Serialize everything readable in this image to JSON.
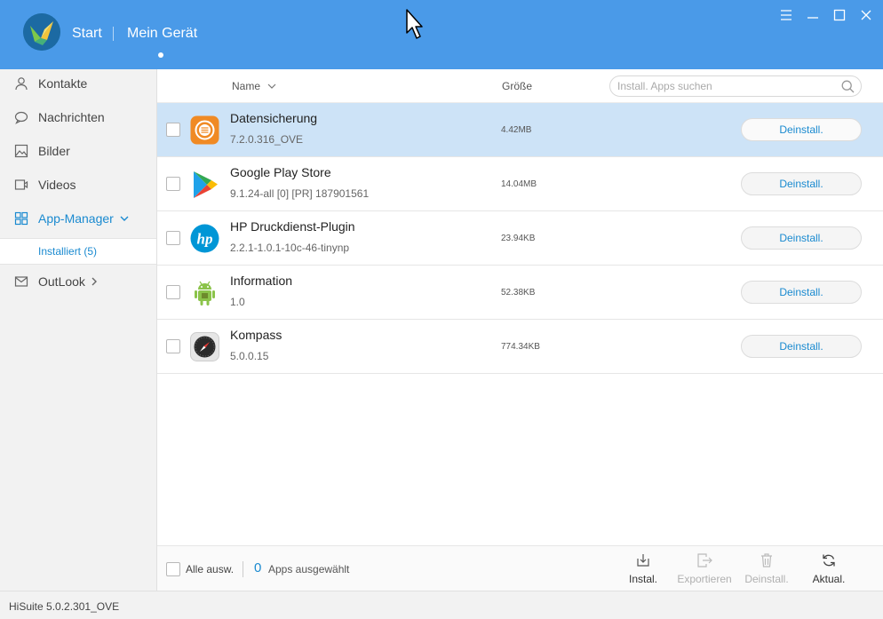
{
  "header": {
    "nav_start": "Start",
    "nav_device": "Mein Gerät",
    "accent": "#4a9ae8"
  },
  "sidebar": {
    "items": [
      {
        "label": "Kontakte",
        "icon": "person-icon"
      },
      {
        "label": "Nachrichten",
        "icon": "chat-bubble-icon"
      },
      {
        "label": "Bilder",
        "icon": "image-icon"
      },
      {
        "label": "Videos",
        "icon": "video-icon"
      },
      {
        "label": "App-Manager",
        "icon": "grid-icon"
      },
      {
        "label": "OutLook",
        "icon": "envelope-icon"
      }
    ],
    "sub_item": "Installiert (5)"
  },
  "table": {
    "col_name": "Name",
    "col_size": "Größe",
    "search_placeholder": "Install. Apps suchen",
    "uninstall_label": "Deinstall.",
    "rows": [
      {
        "name": "Datensicherung",
        "version": "7.2.0.316_OVE",
        "size": "4.42MB",
        "icon": "backup-app-icon",
        "selected": true
      },
      {
        "name": "Google Play Store",
        "version": "9.1.24-all [0] [PR] 187901561",
        "size": "14.04MB",
        "icon": "play-store-icon",
        "selected": false
      },
      {
        "name": "HP Druckdienst-Plugin",
        "version": "2.2.1-1.0.1-10c-46-tinynp",
        "size": "23.94KB",
        "icon": "hp-logo-icon",
        "selected": false
      },
      {
        "name": "Information",
        "version": "1.0",
        "size": "52.38KB",
        "icon": "android-icon",
        "selected": false
      },
      {
        "name": "Kompass",
        "version": "5.0.0.15",
        "size": "774.34KB",
        "icon": "compass-icon",
        "selected": false
      }
    ]
  },
  "bottom": {
    "select_all": "Alle ausw.",
    "selected_count": "0",
    "selected_label": "Apps ausgewählt",
    "install": "Instal.",
    "export": "Exportieren",
    "uninstall": "Deinstall.",
    "refresh": "Aktual."
  },
  "status": {
    "version": "HiSuite 5.0.2.301_OVE"
  }
}
